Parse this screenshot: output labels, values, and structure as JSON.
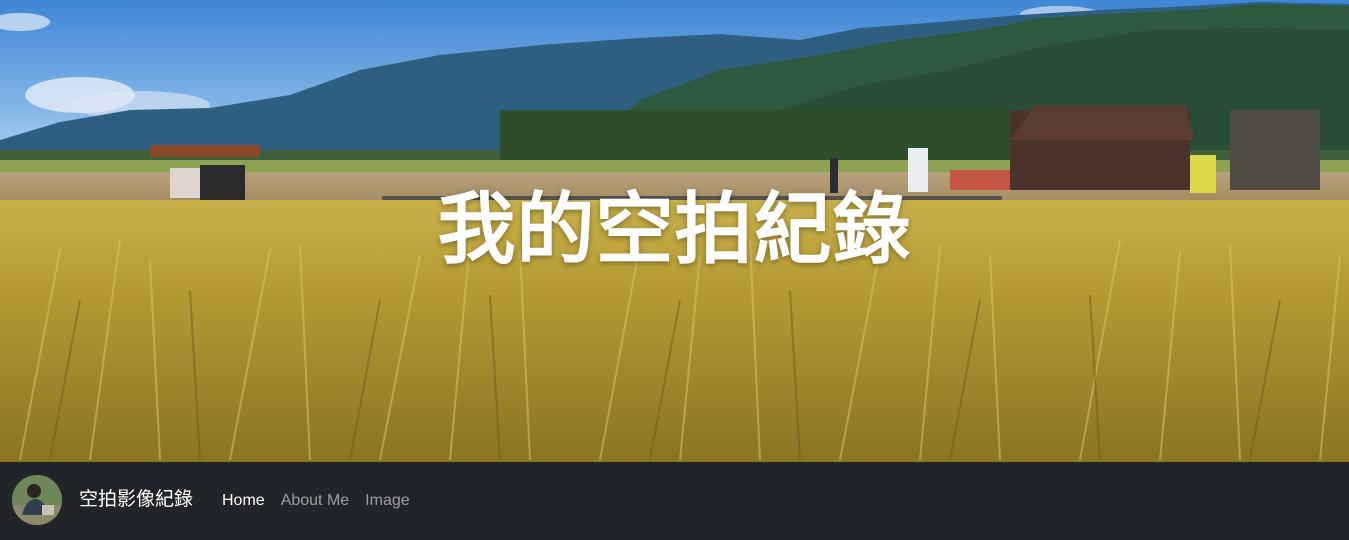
{
  "hero": {
    "title": "我的空拍紀錄",
    "image_icon": "rice-field-landscape-photo"
  },
  "navbar": {
    "avatar_icon": "profile-photo-avatar",
    "brand": "空拍影像紀錄",
    "links": [
      {
        "label": "Home",
        "active": true
      },
      {
        "label": "About Me",
        "active": false
      },
      {
        "label": "Image",
        "active": false
      }
    ]
  },
  "colors": {
    "navbar_bg": "#212529",
    "link_active": "#ffffff",
    "link_muted": "rgba(255,255,255,0.55)"
  }
}
